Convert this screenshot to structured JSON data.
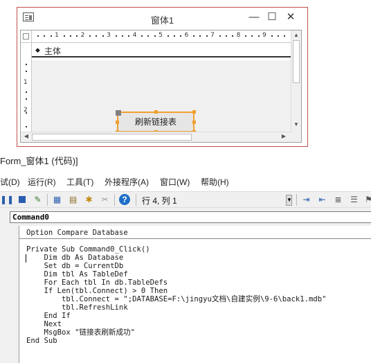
{
  "form_window": {
    "title": "窗体1",
    "minimize_glyph": "—",
    "maximize_glyph": "☐",
    "close_glyph": "✕",
    "icon": "form-icon",
    "ruler_numbers": [
      "1",
      "2",
      "3",
      "4",
      "5",
      "6",
      "7",
      "8",
      "9"
    ],
    "vertical_ruler_numbers": [
      "1",
      "2"
    ],
    "section_label": "主体",
    "command_button_label": "刷新链接表"
  },
  "vba": {
    "window_title": "Form_窗体1 (代码)]",
    "menu": [
      {
        "label": "试(D)"
      },
      {
        "label": "运行(R)"
      },
      {
        "label": "工具(T)"
      },
      {
        "label": "外接程序(A)"
      },
      {
        "label": "窗口(W)"
      },
      {
        "label": "帮助(H)"
      }
    ],
    "toolbar": {
      "position": "行 4, 列 1",
      "icons": [
        "pause-icon",
        "reset-icon",
        "design-mode-icon",
        "project-explorer-icon",
        "properties-icon",
        "object-browser-icon",
        "toolbox-icon",
        "help-icon"
      ]
    },
    "object_combo": "Command0",
    "code_lines": [
      "Option Compare Database",
      "",
      "Private Sub Command0_Click()",
      "    Dim db As Database",
      "    Set db = CurrentDb",
      "    Dim tbl As TableDef",
      "    For Each tbl In db.TableDefs",
      "    If Len(tbl.Connect) > 0 Then",
      "        tbl.Connect = \";DATABASE=F:\\jingyu文档\\自建实例\\9-6\\back1.mdb\"",
      "        tbl.RefreshLink",
      "    End If",
      "    Next",
      "    MsgBox \"链接表刷新成功\"",
      "End Sub"
    ]
  },
  "colors": {
    "selection_orange": "#f0a030",
    "form_border": "#c0504d",
    "help_blue": "#1e6fc8"
  }
}
